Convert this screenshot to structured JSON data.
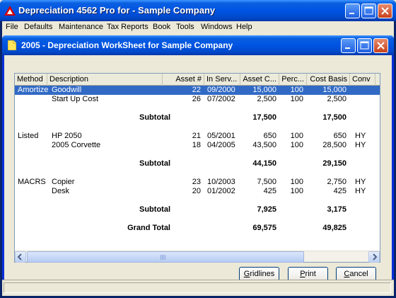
{
  "app": {
    "title": "Depreciation 4562 Pro for - Sample Company"
  },
  "menu": [
    "File",
    "Defaults",
    "Maintenance",
    "Tax Reports",
    "Book",
    "Tools",
    "Windows",
    "Help"
  ],
  "child": {
    "title": "2005 - Depreciation WorkSheet for Sample Company"
  },
  "grid": {
    "headers": [
      "Method",
      "Description",
      "Asset #",
      "In Serv...",
      "Asset C...",
      "Perc...",
      "Cost Basis",
      "Conv"
    ],
    "rows": [
      {
        "method": "Amortize",
        "desc": "Goodwill",
        "asset": "22",
        "inserv": "09/2000",
        "cost": "15,000",
        "perc": "100",
        "basis": "15,000",
        "conv": ""
      },
      {
        "method": "",
        "desc": "Start Up Cost",
        "asset": "26",
        "inserv": "07/2002",
        "cost": "2,500",
        "perc": "100",
        "basis": "2,500",
        "conv": ""
      },
      {
        "method": "",
        "desc": "",
        "asset": "",
        "inserv": "",
        "cost": "",
        "perc": "",
        "basis": "",
        "conv": ""
      },
      {
        "label": "Subtotal",
        "cost": "17,500",
        "basis": "17,500"
      },
      {
        "method": "",
        "desc": "",
        "asset": "",
        "inserv": "",
        "cost": "",
        "perc": "",
        "basis": "",
        "conv": ""
      },
      {
        "method": "Listed",
        "desc": "HP 2050",
        "asset": "21",
        "inserv": "05/2001",
        "cost": "650",
        "perc": "100",
        "basis": "650",
        "conv": "HY"
      },
      {
        "method": "",
        "desc": "2005 Corvette",
        "asset": "18",
        "inserv": "04/2005",
        "cost": "43,500",
        "perc": "100",
        "basis": "28,500",
        "conv": "HY"
      },
      {
        "method": "",
        "desc": "",
        "asset": "",
        "inserv": "",
        "cost": "",
        "perc": "",
        "basis": "",
        "conv": ""
      },
      {
        "label": "Subtotal",
        "cost": "44,150",
        "basis": "29,150"
      },
      {
        "method": "",
        "desc": "",
        "asset": "",
        "inserv": "",
        "cost": "",
        "perc": "",
        "basis": "",
        "conv": ""
      },
      {
        "method": "MACRS",
        "desc": "Copier",
        "asset": "23",
        "inserv": "10/2003",
        "cost": "7,500",
        "perc": "100",
        "basis": "2,750",
        "conv": "HY"
      },
      {
        "method": "",
        "desc": "Desk",
        "asset": "20",
        "inserv": "01/2002",
        "cost": "425",
        "perc": "100",
        "basis": "425",
        "conv": "HY"
      },
      {
        "method": "",
        "desc": "",
        "asset": "",
        "inserv": "",
        "cost": "",
        "perc": "",
        "basis": "",
        "conv": ""
      },
      {
        "label": "Subtotal",
        "cost": "7,925",
        "basis": "3,175"
      },
      {
        "method": "",
        "desc": "",
        "asset": "",
        "inserv": "",
        "cost": "",
        "perc": "",
        "basis": "",
        "conv": ""
      },
      {
        "label": "Grand Total",
        "cost": "69,575",
        "basis": "49,825"
      }
    ],
    "selected_row": 0,
    "scroll_grip": "III"
  },
  "buttons": {
    "gridlines": {
      "accel": "G",
      "rest": "ridlines"
    },
    "print": {
      "accel": "P",
      "rest": "rint"
    },
    "cancel": {
      "accel": "C",
      "rest": "ancel"
    }
  },
  "colors": {
    "titlebar": "#0054e3",
    "selection": "#316ac5",
    "close": "#c8421c"
  }
}
